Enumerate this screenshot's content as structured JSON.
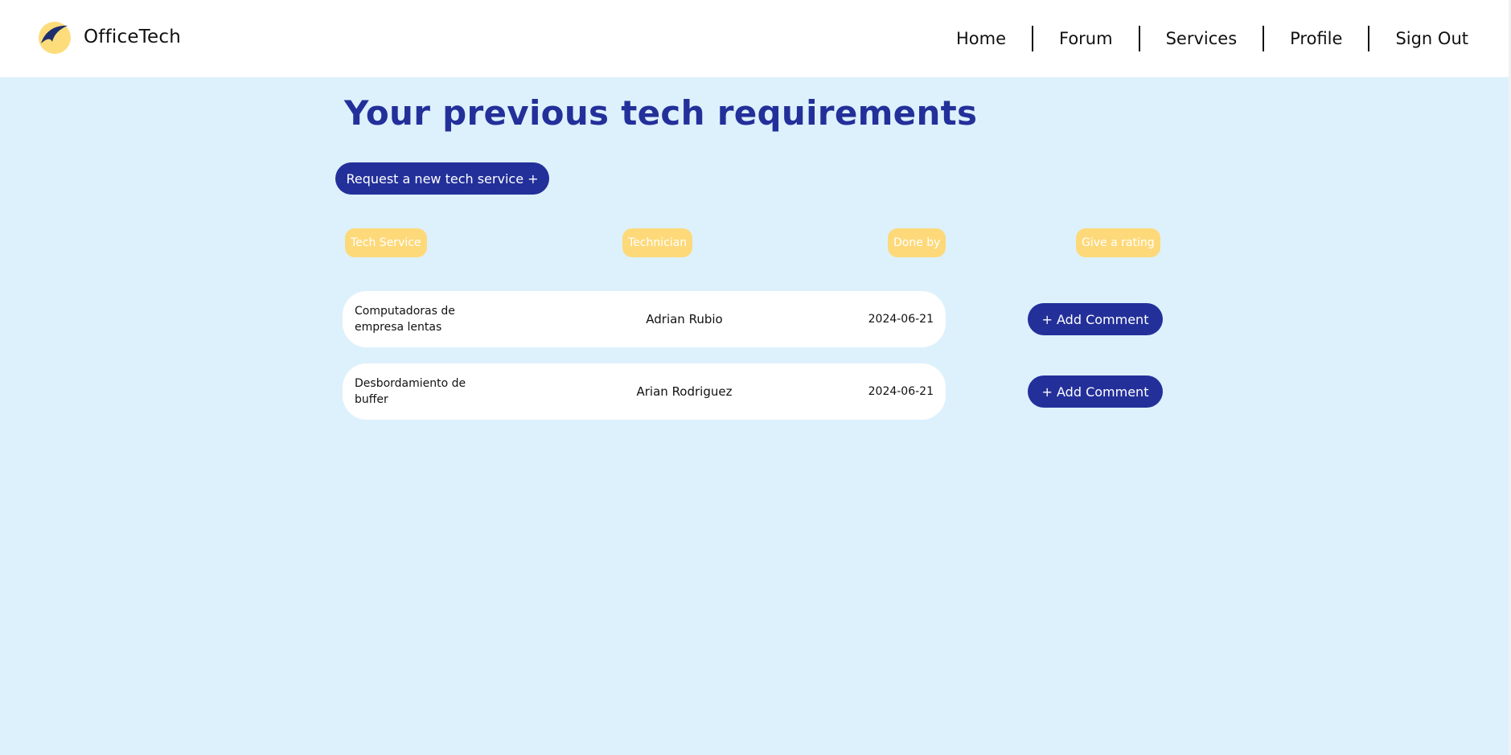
{
  "header": {
    "brand": "OfficeTech",
    "logo_icon": "officetech-logo-icon",
    "nav": [
      "Home",
      "Forum",
      "Services",
      "Profile",
      "Sign Out"
    ]
  },
  "main": {
    "title": "Your previous tech requirements",
    "new_service_button": "Request a new tech service +",
    "columns": {
      "service": "Tech Service",
      "technician": "Technician",
      "done_by": "Done by",
      "rating": "Give a rating"
    },
    "rows": [
      {
        "service": "Computadoras de empresa lentas",
        "technician": "Adrian Rubio",
        "date": "2024-06-21",
        "action": "+ Add Comment"
      },
      {
        "service": "Desbordamiento de buffer",
        "technician": "Arian Rodriguez",
        "date": "2024-06-21",
        "action": "+ Add Comment"
      }
    ]
  },
  "colors": {
    "primary": "#23309a",
    "background": "#ddf1fc",
    "header_pill": "#fdd97a",
    "card": "#ffffff"
  }
}
